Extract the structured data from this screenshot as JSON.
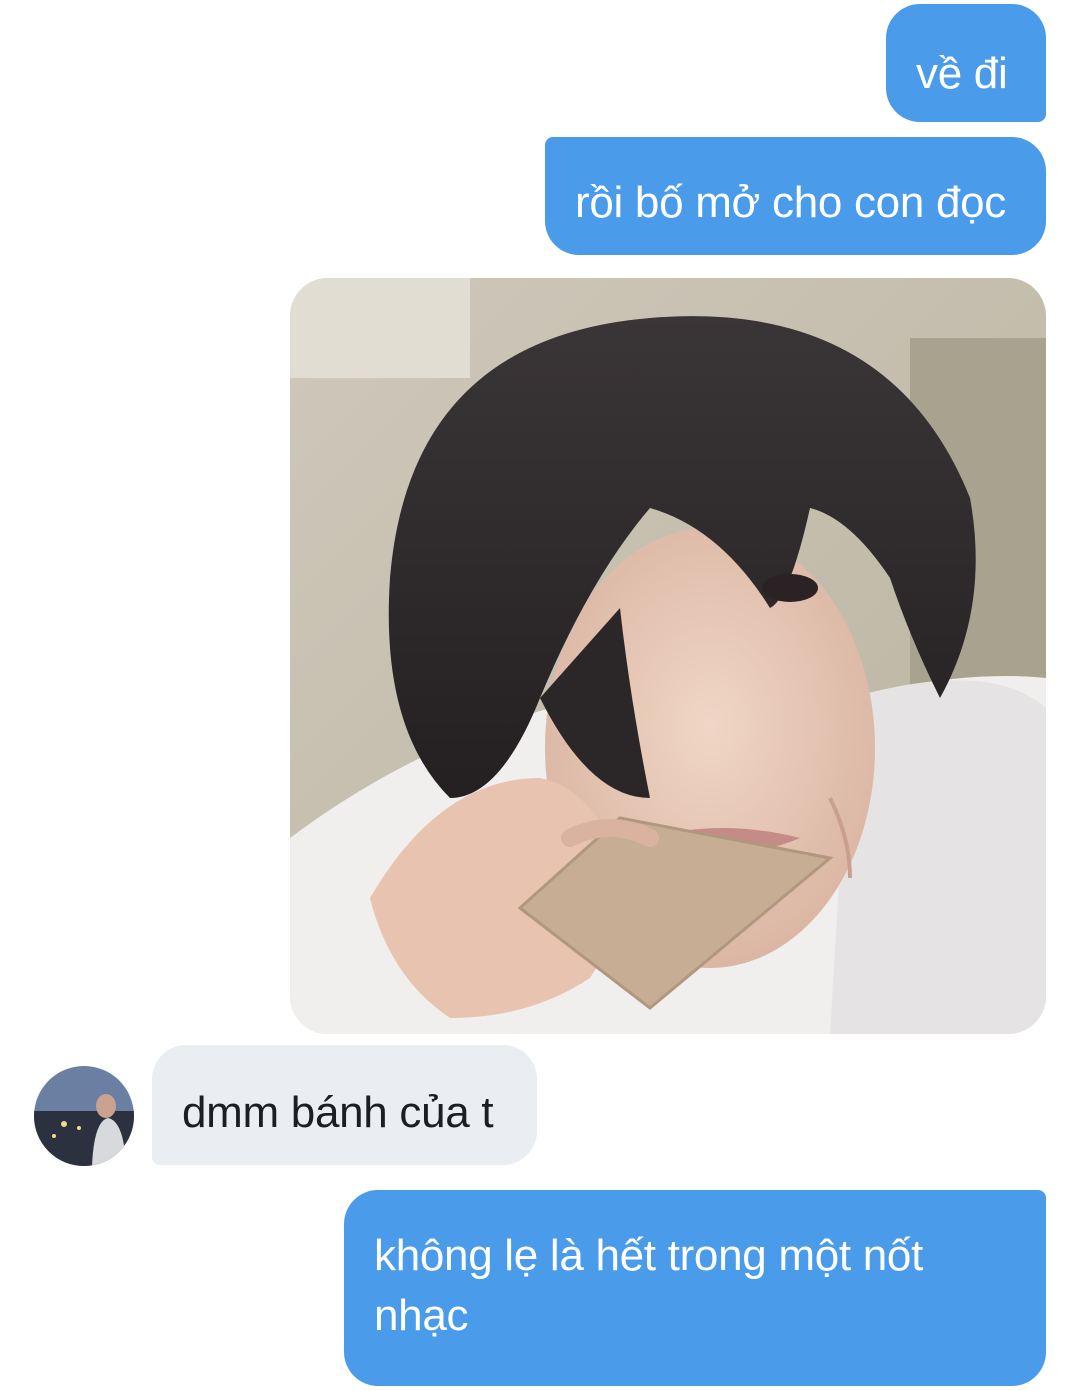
{
  "messages": [
    {
      "direction": "outgoing",
      "text": "về đi"
    },
    {
      "direction": "outgoing",
      "text": "rồi bố mở cho con đọc"
    },
    {
      "direction": "outgoing",
      "type": "photo",
      "icon": "photo-selfie-eating-wafer"
    },
    {
      "direction": "incoming",
      "text": "dmm bánh của t",
      "avatar_icon": "contact-avatar-icon"
    },
    {
      "direction": "outgoing",
      "text": "không lẹ là hết trong một nốt nhạc"
    }
  ],
  "colors": {
    "outgoing_bubble": "#4a9bea",
    "incoming_bubble": "#eaedf2",
    "outgoing_text": "#ffffff",
    "incoming_text": "#1c1e21",
    "background": "#ffffff"
  }
}
